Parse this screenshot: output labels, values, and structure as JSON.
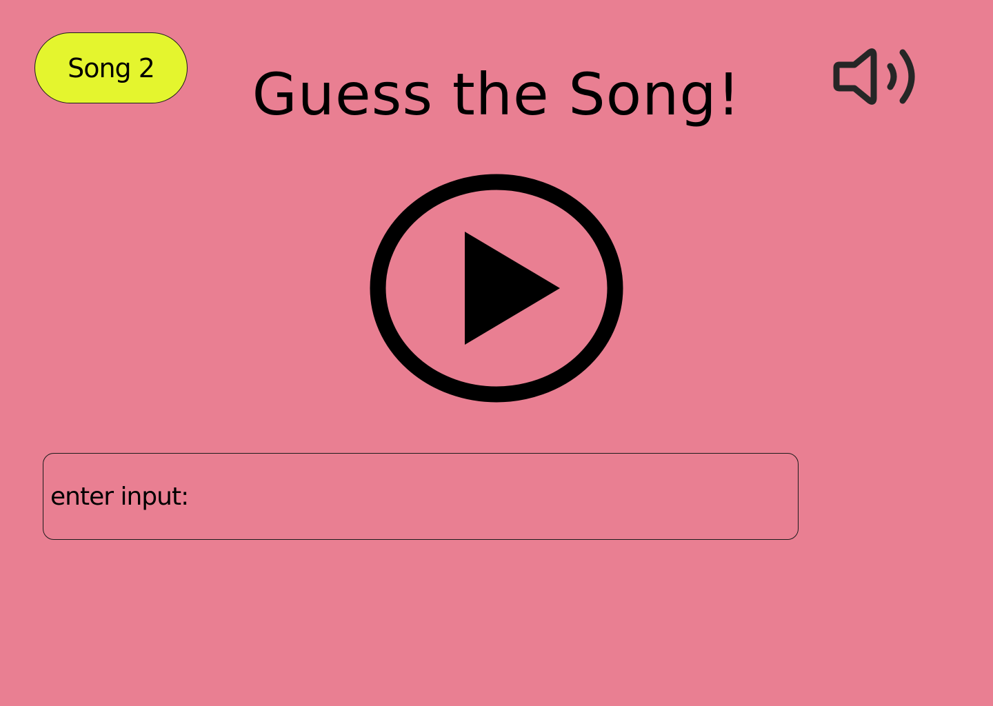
{
  "theme": {
    "background": "#e97f92",
    "pill_color": "#e4f52e",
    "ink": "#000000"
  },
  "song_badge": {
    "label": "Song 2"
  },
  "header": {
    "title": "Guess the Song!"
  },
  "icons": {
    "volume": "speaker-volume-icon",
    "play": "play-circle-icon"
  },
  "guess": {
    "label": "enter input:",
    "value": ""
  }
}
